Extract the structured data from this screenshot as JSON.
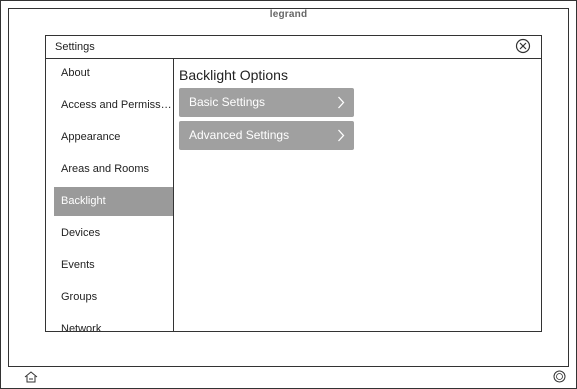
{
  "brand": {
    "name": "legrand"
  },
  "dialog": {
    "title": "Settings",
    "close_icon": "close-circle-icon"
  },
  "sidebar": {
    "items": [
      {
        "label": "About",
        "active": false
      },
      {
        "label": "Access and Permissions",
        "active": false
      },
      {
        "label": "Appearance",
        "active": false
      },
      {
        "label": "Areas and Rooms",
        "active": false
      },
      {
        "label": "Backlight",
        "active": true
      },
      {
        "label": "Devices",
        "active": false
      },
      {
        "label": "Events",
        "active": false
      },
      {
        "label": "Groups",
        "active": false
      },
      {
        "label": "Network",
        "active": false
      }
    ]
  },
  "main": {
    "title": "Backlight Options",
    "options": [
      {
        "label": "Basic Settings",
        "icon": "chevron-right-icon"
      },
      {
        "label": "Advanced Settings",
        "icon": "chevron-right-icon"
      }
    ]
  },
  "bottom_bar": {
    "home_icon": "home-icon",
    "power_icon": "power-icon"
  },
  "colors": {
    "active_item_bg": "#9a9a9a",
    "option_bg": "#a0a0a0",
    "border": "#333333"
  }
}
